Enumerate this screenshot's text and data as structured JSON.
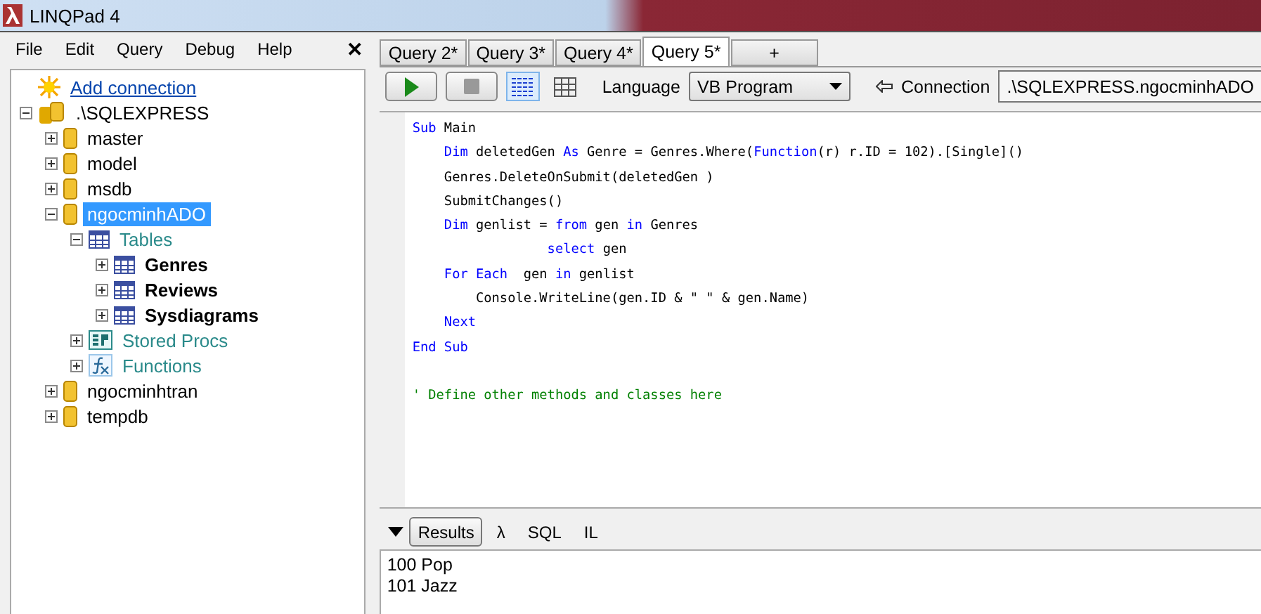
{
  "window": {
    "title": "LINQPad 4"
  },
  "menu": [
    "File",
    "Edit",
    "Query",
    "Debug",
    "Help"
  ],
  "close_panel": "✕",
  "tree": [
    {
      "label": "Add connection",
      "kind": "add",
      "selected": false
    },
    {
      "label": ".\\SQLEXPRESS",
      "kind": "server",
      "expanded": true,
      "selected": false,
      "children": [
        {
          "label": "master",
          "kind": "database",
          "expanded": false,
          "selected": false
        },
        {
          "label": "model",
          "kind": "database",
          "expanded": false,
          "selected": false
        },
        {
          "label": "msdb",
          "kind": "database",
          "expanded": false,
          "selected": false
        },
        {
          "label": "ngocminhADO",
          "kind": "database",
          "expanded": true,
          "selected": true,
          "children": [
            {
              "label": "Tables",
              "kind": "tables",
              "expanded": true,
              "selected": false,
              "children": [
                {
                  "label": "Genres",
                  "kind": "table",
                  "expanded": false,
                  "selected": false
                },
                {
                  "label": "Reviews",
                  "kind": "table",
                  "expanded": false,
                  "selected": false
                },
                {
                  "label": "Sysdiagrams",
                  "kind": "table",
                  "expanded": false,
                  "selected": false
                }
              ]
            },
            {
              "label": "Stored Procs",
              "kind": "procs",
              "expanded": false,
              "selected": false
            },
            {
              "label": "Functions",
              "kind": "functions",
              "expanded": false,
              "selected": false
            }
          ]
        },
        {
          "label": "ngocminhtran",
          "kind": "database",
          "expanded": false,
          "selected": false
        },
        {
          "label": "tempdb",
          "kind": "database",
          "expanded": false,
          "selected": false
        }
      ]
    }
  ],
  "tabs": [
    {
      "label": "Query 2*",
      "selected": false
    },
    {
      "label": "Query 3*",
      "selected": false
    },
    {
      "label": "Query 4*",
      "selected": false
    },
    {
      "label": "Query 5*",
      "selected": true
    }
  ],
  "new_tab": "+",
  "toolbar": {
    "rich_view_selected": true,
    "grid_view_selected": false,
    "language_label": "Language",
    "language": "VB Program",
    "connection_label": "Connection",
    "connection": ".\\SQLEXPRESS.ngocminhADO"
  },
  "code": [
    [
      {
        "kind": "keyword",
        "text": "Sub"
      },
      {
        "kind": "plain",
        "text": " Main"
      }
    ],
    [
      {
        "kind": "keyword",
        "text": "    Dim"
      },
      {
        "kind": "plain",
        "text": " deletedGen "
      },
      {
        "kind": "keyword",
        "text": "As"
      },
      {
        "kind": "plain",
        "text": " Genre = Genres.Where("
      },
      {
        "kind": "keyword",
        "text": "Function"
      },
      {
        "kind": "plain",
        "text": "(r) r.ID = 102).[Single]()"
      }
    ],
    [
      {
        "kind": "plain",
        "text": "    Genres.DeleteOnSubmit(deletedGen )"
      }
    ],
    [
      {
        "kind": "plain",
        "text": "    SubmitChanges()"
      }
    ],
    [
      {
        "kind": "keyword",
        "text": "    Dim"
      },
      {
        "kind": "plain",
        "text": " genlist = "
      },
      {
        "kind": "keyword",
        "text": "from"
      },
      {
        "kind": "plain",
        "text": " gen "
      },
      {
        "kind": "keyword",
        "text": "in"
      },
      {
        "kind": "plain",
        "text": " Genres"
      }
    ],
    [
      {
        "kind": "keyword",
        "text": "                 select"
      },
      {
        "kind": "plain",
        "text": " gen"
      }
    ],
    [
      {
        "kind": "keyword",
        "text": "    For Each"
      },
      {
        "kind": "plain",
        "text": "  gen "
      },
      {
        "kind": "keyword",
        "text": "in"
      },
      {
        "kind": "plain",
        "text": " genlist"
      }
    ],
    [
      {
        "kind": "plain",
        "text": "        Console.WriteLine(gen.ID & \" \" & gen.Name)"
      }
    ],
    [
      {
        "kind": "keyword",
        "text": "    Next"
      }
    ],
    [
      {
        "kind": "keyword",
        "text": "End Sub"
      }
    ],
    [
      {
        "kind": "comment",
        "text": "' Define other methods and classes here"
      }
    ]
  ],
  "result_tabs": [
    {
      "label": "Results",
      "selected": true
    },
    {
      "label": "λ",
      "selected": false
    },
    {
      "label": "SQL",
      "selected": false
    },
    {
      "label": "IL",
      "selected": false
    }
  ],
  "output": [
    "100 Pop",
    "101 Jazz"
  ]
}
